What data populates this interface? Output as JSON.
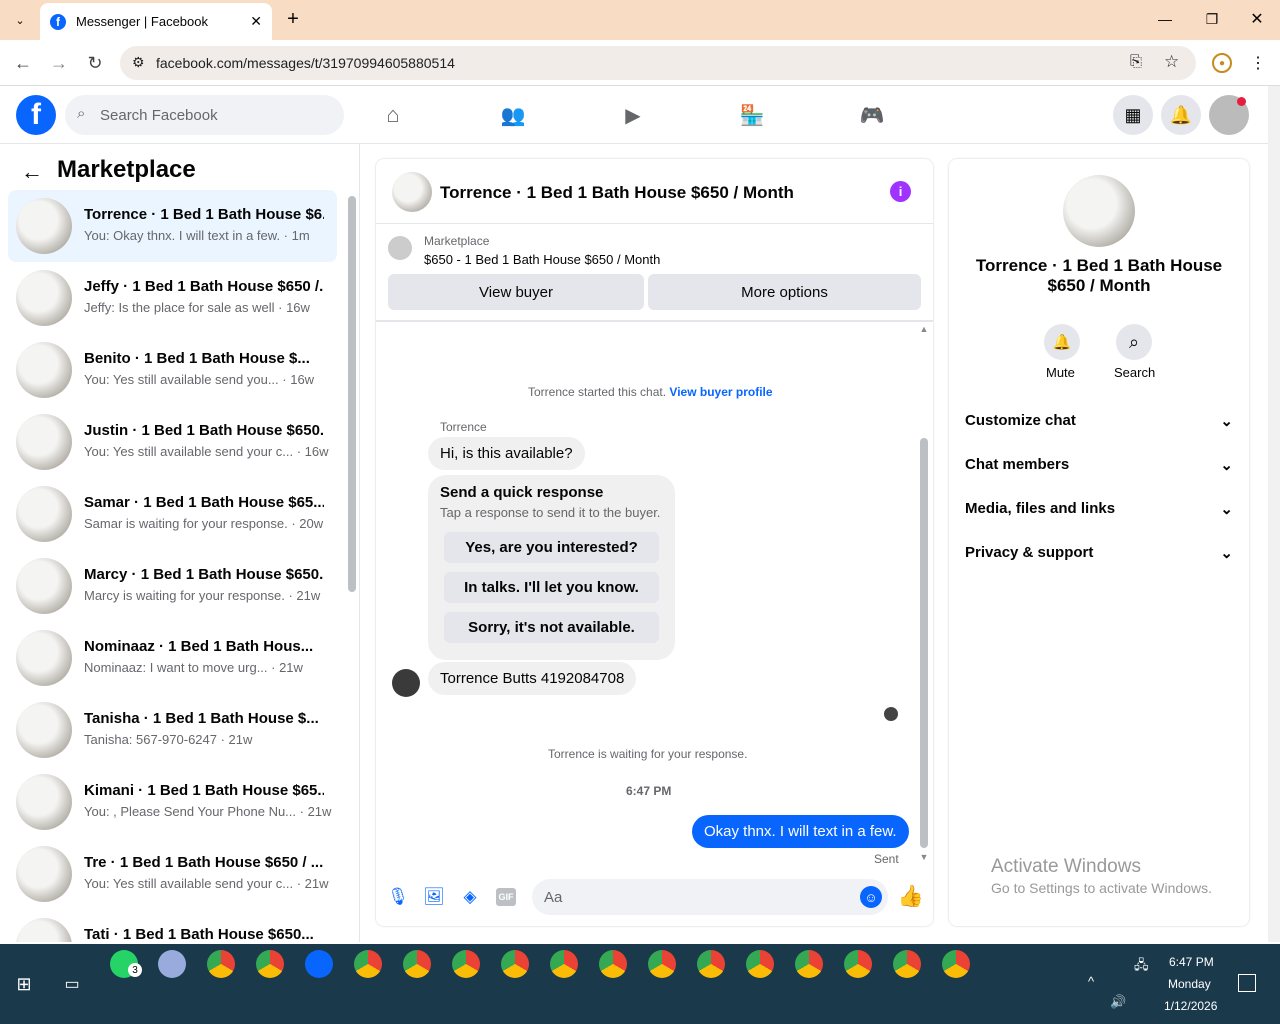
{
  "browser": {
    "tab_title": "Messenger | Facebook",
    "url": "facebook.com/messages/t/31970994605880514"
  },
  "header": {
    "search_placeholder": "Search Facebook"
  },
  "sidebar": {
    "title": "Marketplace",
    "conversations": [
      {
        "name": "Torrence · 1 Bed 1 Bath House $6...",
        "preview": "You: Okay thnx. I will text in a few. · 1m"
      },
      {
        "name": "Jeffy · 1 Bed 1 Bath House $650 /...",
        "preview": "Jeffy: Is the place for sale as well · 16w"
      },
      {
        "name": "Benito · 1 Bed 1 Bath House $...",
        "preview": "You: Yes still available send you... · 16w"
      },
      {
        "name": "Justin · 1 Bed 1 Bath House $650...",
        "preview": "You: Yes still available send your c... · 16w"
      },
      {
        "name": "Samar · 1 Bed 1 Bath House $65...",
        "preview": "Samar is waiting for your response. · 20w"
      },
      {
        "name": "Marcy · 1 Bed 1 Bath House $650...",
        "preview": "Marcy is waiting for your response. · 21w"
      },
      {
        "name": "Nominaaz · 1 Bed 1 Bath Hous...",
        "preview": "Nominaaz: I want to move urg... · 21w"
      },
      {
        "name": "Tanisha · 1 Bed 1 Bath House $...",
        "preview": "Tanisha: 567-970-6247 · 21w"
      },
      {
        "name": "Kimani · 1 Bed 1 Bath House $65...",
        "preview": "You: , Please Send Your Phone Nu... · 21w"
      },
      {
        "name": "Tre · 1 Bed 1 Bath House $650 / ...",
        "preview": "You: Yes still available send your c... · 21w"
      },
      {
        "name": "Tati · 1 Bed 1 Bath House $650...",
        "preview": ""
      }
    ]
  },
  "chat": {
    "title": "Torrence · 1 Bed 1 Bath House $650 / Month",
    "listing_source": "Marketplace",
    "listing_desc": "$650 - 1 Bed 1 Bath House $650 / Month",
    "view_buyer": "View buyer",
    "more_options": "More options",
    "started_text": "Torrence started this chat.",
    "buyer_profile_link": "View buyer profile",
    "sender_name": "Torrence",
    "msg1": "Hi, is this available?",
    "quick_title": "Send a quick response",
    "quick_sub": "Tap a response to send it to the buyer.",
    "quick_replies": [
      "Yes, are you interested?",
      "In talks. I'll let you know.",
      "Sorry, it's not available."
    ],
    "msg2": "Torrence Butts 4192084708",
    "waiting_text": "Torrence is waiting for your response.",
    "time": "6:47 PM",
    "my_msg": "Okay thnx. I will text in a few.",
    "sent": "Sent",
    "composer_placeholder": "Aa"
  },
  "info_panel": {
    "title": "Torrence · 1 Bed 1 Bath House $650 / Month",
    "mute": "Mute",
    "search": "Search",
    "sections": [
      "Customize chat",
      "Chat members",
      "Media, files and links",
      "Privacy & support"
    ]
  },
  "watermark": {
    "line1": "Activate Windows",
    "line2": "Go to Settings to activate Windows."
  },
  "taskbar": {
    "whatsapp_badge": "3",
    "time": "6:47 PM",
    "day": "Monday",
    "date": "1/12/2026"
  },
  "colors": {
    "brand": "#0866ff",
    "accent_purple": "#a033ff"
  }
}
